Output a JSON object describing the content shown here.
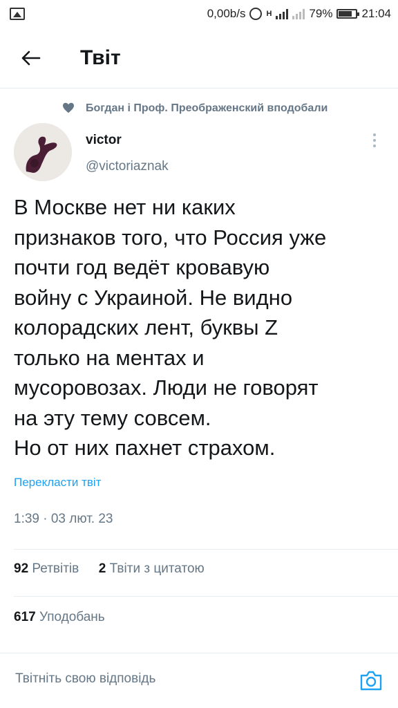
{
  "status_bar": {
    "speed": "0,00b/s",
    "network": "H",
    "battery": "79%",
    "time": "21:04"
  },
  "header": {
    "title": "Твіт"
  },
  "social_context": {
    "text": "Богдан і Проф. Преображенский вподобали"
  },
  "author": {
    "name": "victor",
    "handle": "@victoriaznak"
  },
  "tweet": {
    "lines": [
      "В Москве нет ни каких",
      "признаков того, что Россия уже",
      "почти год ведёт кровавую",
      "войну с Украиной. Не видно",
      "колорадских лент, буквы Z",
      "только на ментах и",
      "мусоровозах. Люди не говорят",
      "на эту тему совсем.",
      "Но от них пахнет страхом."
    ],
    "translate_label": "Перекласти твіт",
    "timestamp": "1:39 · 03 лют. 23"
  },
  "stats": {
    "retweets_count": "92",
    "retweets_label": "Ретвітів",
    "quotes_count": "2",
    "quotes_label": "Твіти з цитатою",
    "likes_count": "617",
    "likes_label": "Уподобань"
  },
  "reply": {
    "placeholder": "Твітніть свою відповідь"
  },
  "colors": {
    "accent": "#1da1f2",
    "secondary_text": "#657786",
    "primary_text": "#14171a"
  },
  "icons": [
    "back-arrow-icon",
    "heart-icon",
    "more-vertical-icon",
    "camera-icon"
  ]
}
